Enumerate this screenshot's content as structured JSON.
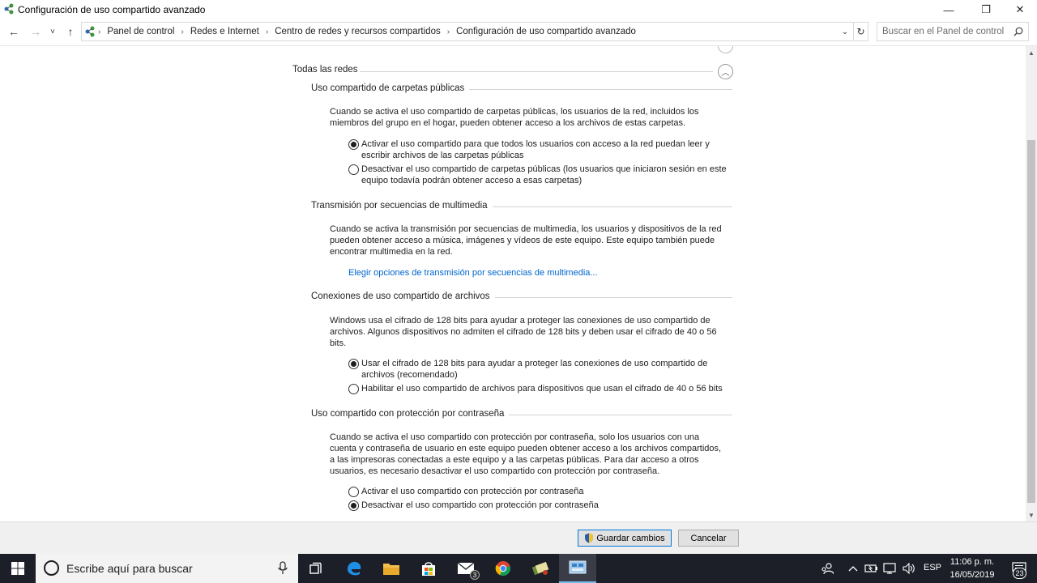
{
  "window": {
    "title": "Configuración de uso compartido avanzado",
    "minimize_glyph": "—",
    "maximize_glyph": "❐",
    "close_glyph": "✕"
  },
  "nav": {
    "back_glyph": "←",
    "forward_glyph": "→",
    "recent_glyph": "˅",
    "up_glyph": "↑",
    "breadcrumb": [
      "Panel de control",
      "Redes e Internet",
      "Centro de redes y recursos compartidos",
      "Configuración de uso compartido avanzado"
    ],
    "separator": "›",
    "dropdown_glyph": "⌄",
    "refresh_glyph": "↻",
    "search_placeholder": "Buscar en el Panel de control"
  },
  "group": {
    "title": "Todas las redes",
    "collapse_glyph": "︿"
  },
  "sections": [
    {
      "title": "Uso compartido de carpetas públicas",
      "description": "Cuando se activa el uso compartido de carpetas públicas, los usuarios de la red, incluidos los miembros del grupo en el hogar, pueden obtener acceso a los archivos de estas carpetas.",
      "options": [
        {
          "label": "Activar el uso compartido para que todos los usuarios con acceso a la red puedan leer y escribir archivos de las carpetas públicas",
          "checked": true
        },
        {
          "label": "Desactivar el uso compartido de carpetas públicas (los usuarios que iniciaron sesión en este equipo todavía podrán obtener acceso a esas carpetas)",
          "checked": false
        }
      ]
    },
    {
      "title": "Transmisión por secuencias de multimedia",
      "description": "Cuando se activa la transmisión por secuencias de multimedia, los usuarios y dispositivos de la red pueden obtener acceso a música, imágenes y vídeos de este equipo. Este equipo también puede encontrar multimedia en la red.",
      "link": "Elegir opciones de transmisión por secuencias de multimedia..."
    },
    {
      "title": "Conexiones de uso compartido de archivos",
      "description": "Windows usa el cifrado de 128 bits para ayudar a proteger las conexiones de uso compartido de archivos. Algunos dispositivos no admiten el cifrado de 128 bits y deben usar el cifrado de 40 o 56 bits.",
      "options": [
        {
          "label": "Usar el cifrado de 128 bits para ayudar a proteger las conexiones de uso compartido de archivos (recomendado)",
          "checked": true
        },
        {
          "label": "Habilitar el uso compartido de archivos para dispositivos que usan el cifrado de 40 o 56 bits",
          "checked": false
        }
      ]
    },
    {
      "title": "Uso compartido con protección por contraseña",
      "description": "Cuando se activa el uso compartido con protección por contraseña, solo los usuarios con una cuenta y contraseña de usuario en este equipo pueden obtener acceso a los archivos compartidos, a las impresoras conectadas a este equipo y a las carpetas públicas. Para dar acceso a otros usuarios, es necesario desactivar el uso compartido con protección por contraseña.",
      "options": [
        {
          "label": "Activar el uso compartido con protección por contraseña",
          "checked": false
        },
        {
          "label": "Desactivar el uso compartido con protección por contraseña",
          "checked": true
        }
      ]
    }
  ],
  "footer": {
    "save_label": "Guardar cambios",
    "cancel_label": "Cancelar"
  },
  "taskbar": {
    "search_placeholder": "Escribe aquí para buscar",
    "mail_badge": "3",
    "language": "ESP",
    "time": "11:06 p. m.",
    "date": "16/05/2019",
    "notifications_count": "23"
  },
  "colors": {
    "link": "#0066cc",
    "taskbar": "#1c1f28",
    "accent": "#0078d7"
  }
}
